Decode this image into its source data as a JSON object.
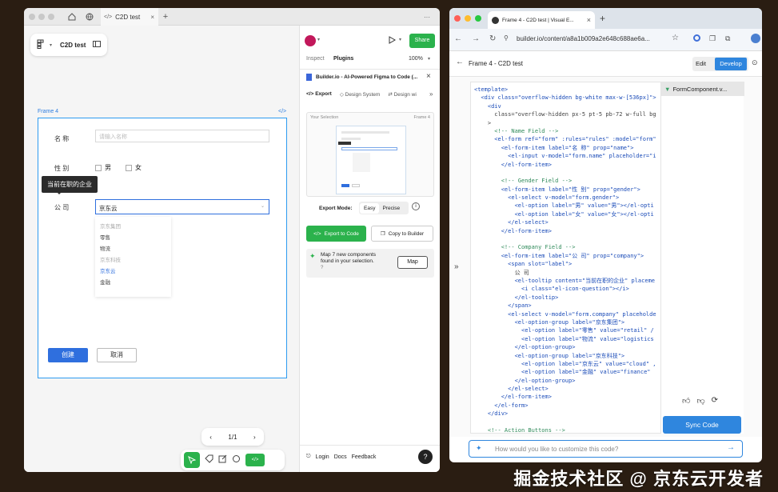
{
  "figma": {
    "tab_title": "C2D test",
    "file_name": "C2D test",
    "frame_label": "Frame 4",
    "frame_code_icon": "</>",
    "form": {
      "name_label": "名 称",
      "name_placeholder": "请输入名称",
      "gender_label": "性 别",
      "gender_male": "男",
      "gender_female": "女",
      "tooltip_text": "当前在职的企业",
      "company_label": "公 司",
      "company_value": "京东云",
      "dropdown_items": [
        "京东集团",
        "零售",
        "物流",
        "京东科技",
        "京东云",
        "金融"
      ],
      "create_button": "创建",
      "cancel_button": "取消"
    },
    "pagination": "1/1",
    "panel": {
      "share": "Share",
      "tab_inspect": "Inspect",
      "tab_plugins": "Plugins",
      "zoom": "100%",
      "plugin_title": "Builder.io - AI-Powered Figma to Code (...",
      "export_tab": "Export",
      "design_system_tab": "Design System",
      "design_wi_tab": "Design wi",
      "preview_left": "Your Selection",
      "preview_right": "Frame 4",
      "export_mode_label": "Export Mode:",
      "mode_easy": "Easy",
      "mode_precise": "Precise",
      "export_to_code": "Export to Code",
      "copy_to_builder": "Copy to Builder",
      "map_message": "Map 7 new components found in your selection.",
      "map_button": "Map",
      "footer_login": "Login",
      "footer_docs": "Docs",
      "footer_feedback": "Feedback",
      "help": "?"
    }
  },
  "chrome": {
    "tab_title": "Frame 4 - C2D test | Visual E...",
    "url": "builder.io/content/a8a1b009a2e648c688ae6a...",
    "page_title": "Frame 4 - C2D test",
    "edit_button": "Edit",
    "develop_button": "Develop",
    "file_tab": "FormComponent.v...",
    "sync_button": "Sync Code",
    "prompt_placeholder": "How would you like to customize this code?",
    "code_lines": [
      "<template>",
      "  <div class=\"overflow-hidden bg-white max-w-[536px]\">",
      "    <div",
      "      class=\"overflow-hidden px-5 pt-5 pb-72 w-full bg",
      "    >",
      "      <!-- Name Field -->",
      "      <el-form ref=\"form\" :rules=\"rules\" :model=\"form\"",
      "        <el-form-item label=\"名 称\" prop=\"name\">",
      "          <el-input v-model=\"form.name\" placeholder=\"i",
      "        </el-form-item>",
      "",
      "        <!-- Gender Field -->",
      "        <el-form-item label=\"性 别\" prop=\"gender\">",
      "          <el-select v-model=\"form.gender\">",
      "            <el-option label=\"男\" value=\"男\"></el-opti",
      "            <el-option label=\"女\" value=\"女\"></el-opti",
      "          </el-select>",
      "        </el-form-item>",
      "",
      "        <!-- Company Field -->",
      "        <el-form-item label=\"公 司\" prop=\"company\">",
      "          <span slot=\"label\">",
      "            公 司",
      "            <el-tooltip content=\"当前在职的企业\" placeme",
      "              <i class=\"el-icon-question\"></i>",
      "            </el-tooltip>",
      "          </span>",
      "          <el-select v-model=\"form.company\" placeholde",
      "            <el-option-group label=\"京东集团\">",
      "              <el-option label=\"零售\" value=\"retail\" /",
      "              <el-option label=\"物流\" value=\"logistics",
      "            </el-option-group>",
      "            <el-option-group label=\"京东科技\">",
      "              <el-option label=\"京东云\" value=\"cloud\" ,",
      "              <el-option label=\"金融\" value=\"finance\"",
      "            </el-option-group>",
      "          </el-select>",
      "        </el-form-item>",
      "      </el-form>",
      "    </div>",
      "",
      "    <!-- Action Buttons -->"
    ]
  },
  "watermark": "掘金技术社区 @ 京东云开发者",
  "colors": {
    "accent_green": "#2bb24c",
    "accent_blue": "#2f6fde",
    "frame_blue": "#2d9bf0"
  }
}
